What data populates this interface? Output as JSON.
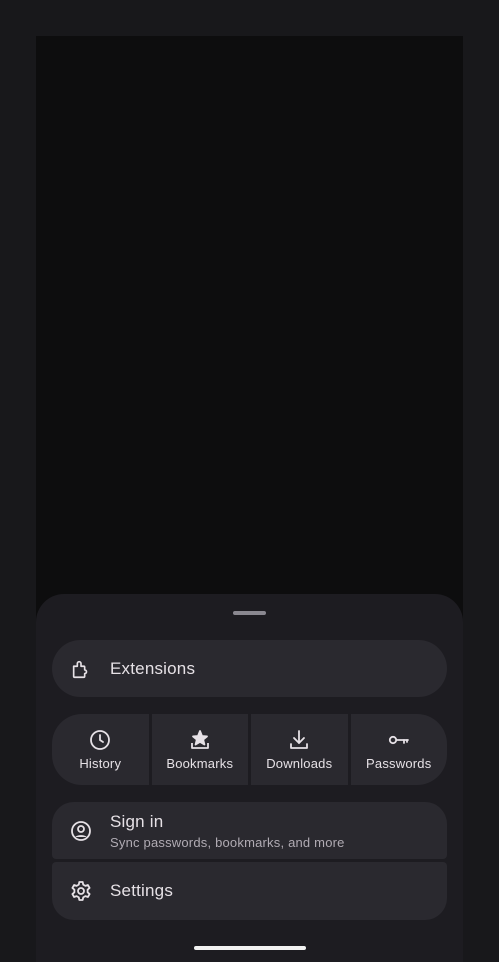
{
  "menu": {
    "extensions_label": "Extensions",
    "quick_actions": [
      {
        "label": "History",
        "icon": "history-icon"
      },
      {
        "label": "Bookmarks",
        "icon": "bookmark-star-icon"
      },
      {
        "label": "Downloads",
        "icon": "download-icon"
      },
      {
        "label": "Passwords",
        "icon": "key-icon"
      }
    ],
    "signin": {
      "title": "Sign in",
      "subtitle": "Sync passwords, bookmarks, and more",
      "icon": "account-circle-icon"
    },
    "settings_label": "Settings"
  },
  "colors": {
    "background": "#18181b",
    "content": "#0d0d0e",
    "sheet": "#1d1c21",
    "row": "#2a292f",
    "text": "#e6e1e6",
    "subtext": "#b0abb3"
  }
}
